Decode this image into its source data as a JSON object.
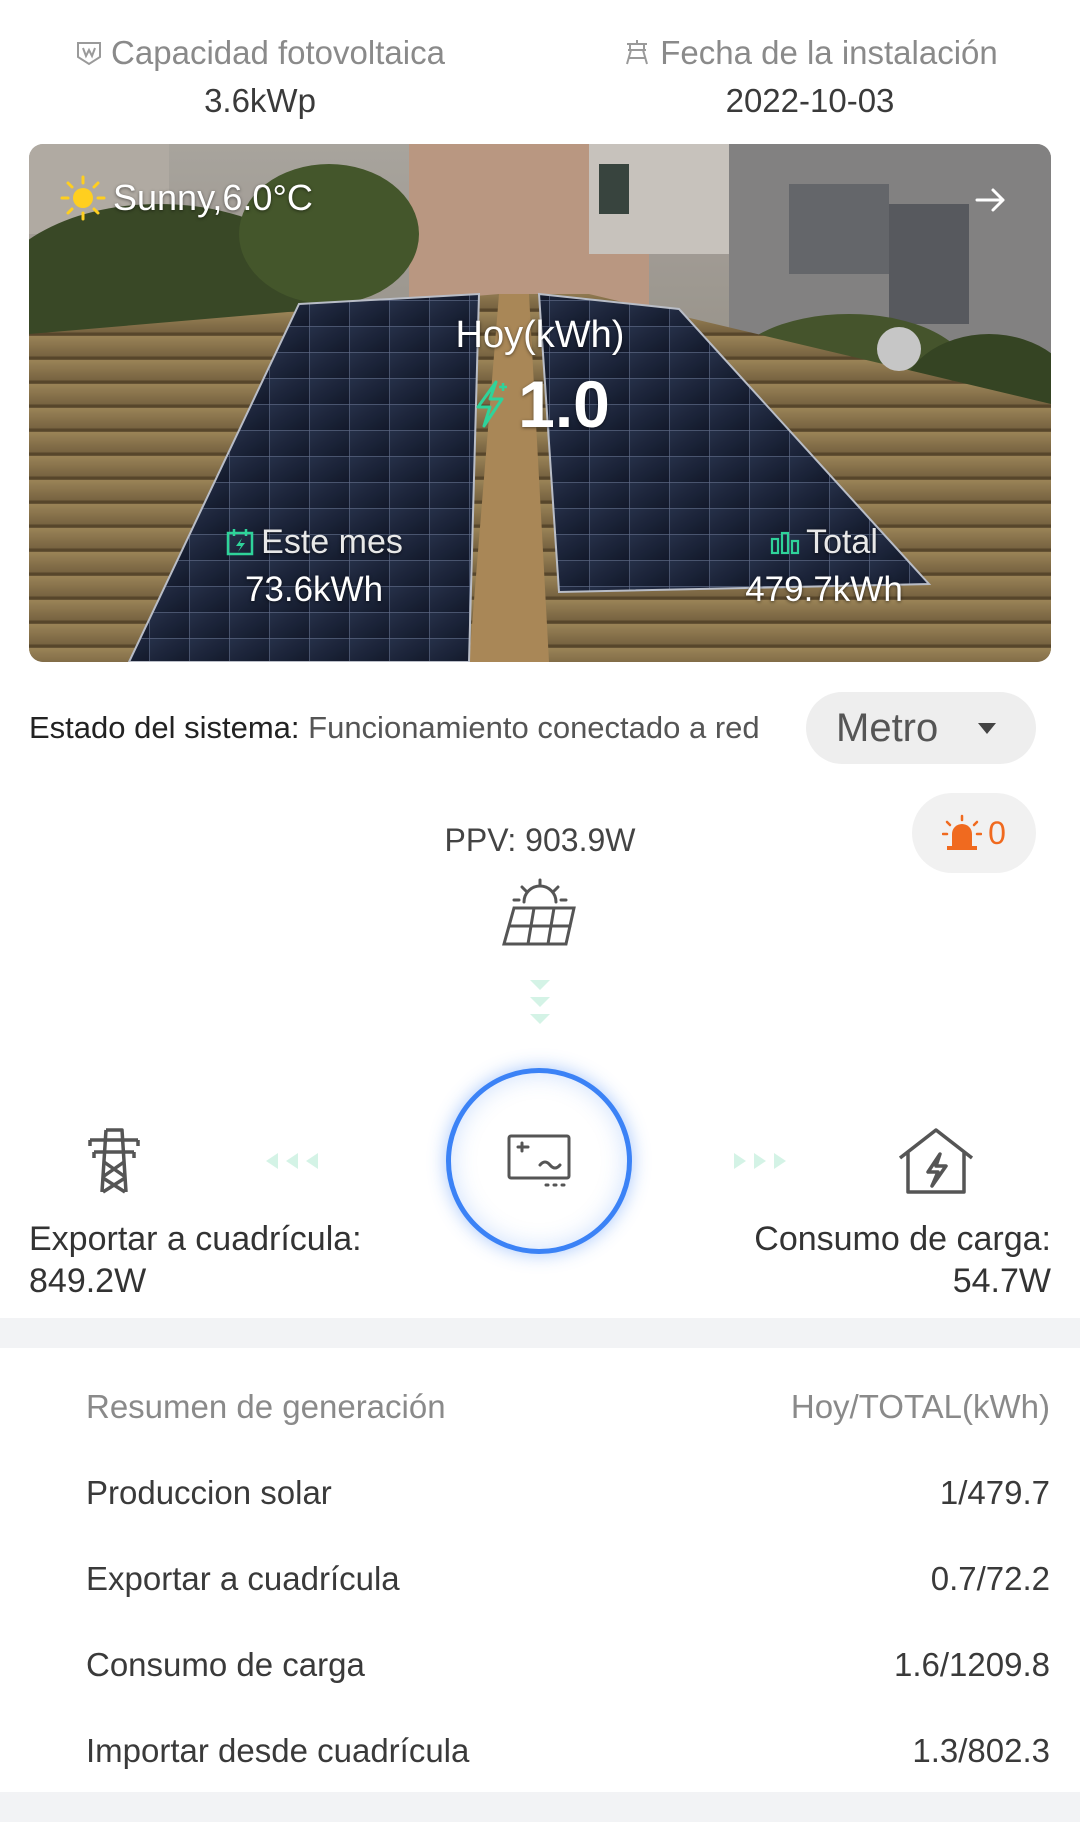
{
  "info": {
    "capacity": {
      "label": "Capacidad fotovoltaica",
      "value": "3.6kWp",
      "icon": "panel-badge-icon"
    },
    "install": {
      "label": "Fecha de la instalación",
      "value": "2022-10-03",
      "icon": "installation-icon"
    }
  },
  "hero": {
    "weather": "Sunny,6.0°C",
    "today_label": "Hoy(kWh)",
    "today_value": "1.0",
    "month_label": "Este mes",
    "month_value": "73.6kWh",
    "total_label": "Total",
    "total_value": "479.7kWh"
  },
  "status": {
    "label": "Estado del sistema:",
    "value": " Funcionamiento conectado a red",
    "selector": "Metro"
  },
  "alarm": {
    "count": "0"
  },
  "flow": {
    "ppv": "PPV: 903.9W",
    "export_label": "Exportar a cuadrícula:",
    "export_value": "849.2W",
    "load_label": "Consumo de carga:",
    "load_value": "54.7W"
  },
  "summary": {
    "title": "Resumen de generación",
    "unit": "Hoy/TOTAL(kWh)",
    "rows": [
      {
        "label": "Produccion solar",
        "value": "1/479.7"
      },
      {
        "label": "Exportar a cuadrícula",
        "value": "0.7/72.2"
      },
      {
        "label": "Consumo de carga",
        "value": "1.6/1209.8"
      },
      {
        "label": "Importar desde cuadrícula",
        "value": "1.3/802.3"
      }
    ]
  },
  "colors": {
    "accent": "#2fd39a",
    "alarm": "#f06a1f",
    "inverter_ring": "#3b82f6"
  }
}
